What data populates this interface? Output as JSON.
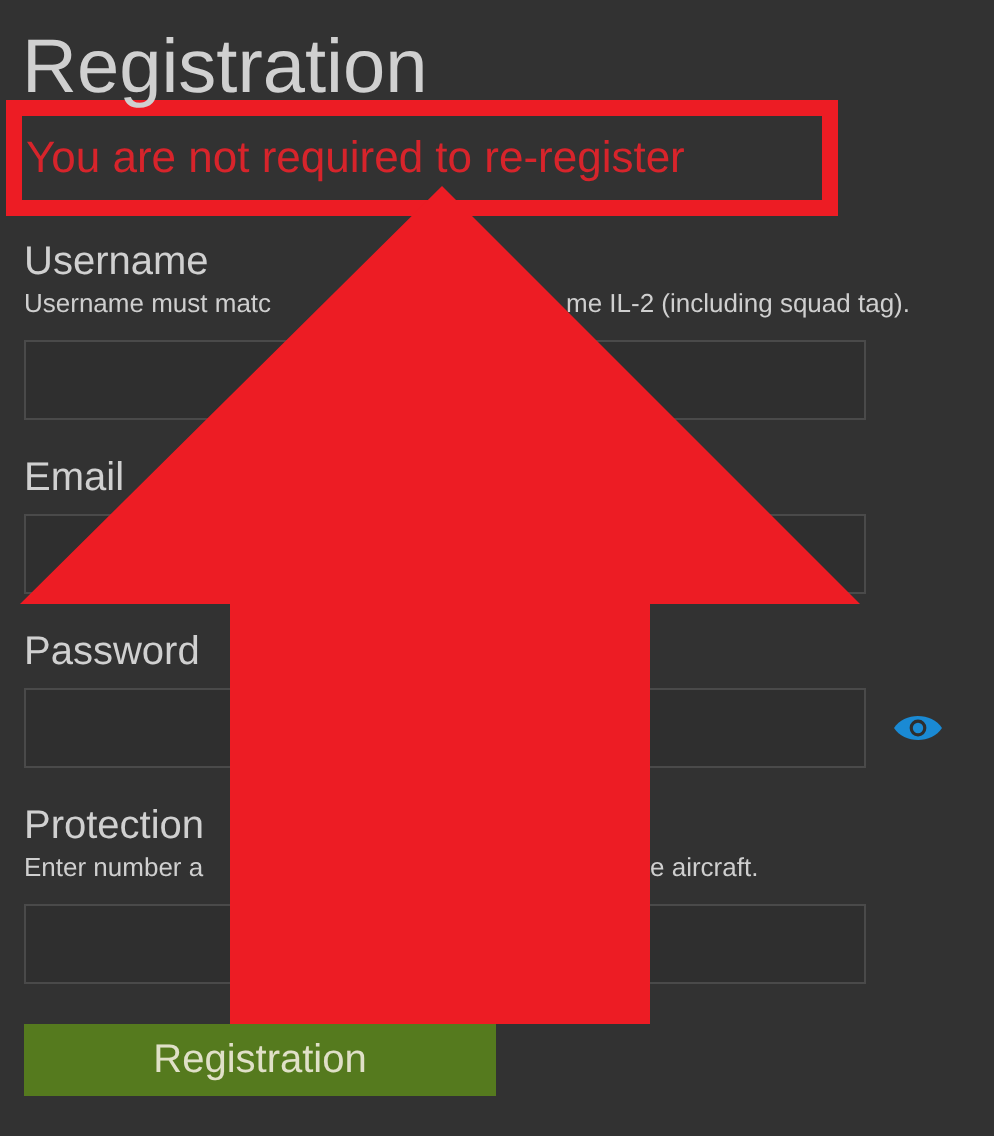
{
  "title": "Registration",
  "notice": "You are not required to re-register",
  "fields": [
    {
      "label": "Username",
      "kind": "text",
      "hint": [
        "Username must matc",
        "me IL-2 (including squad tag)."
      ]
    },
    {
      "label": "Email",
      "kind": "text"
    },
    {
      "label": "Password",
      "kind": "password"
    },
    {
      "label": "Protection",
      "kind": "text",
      "hint": [
        "Enter number a",
        "e aircraft."
      ]
    }
  ],
  "submit": "Registration"
}
